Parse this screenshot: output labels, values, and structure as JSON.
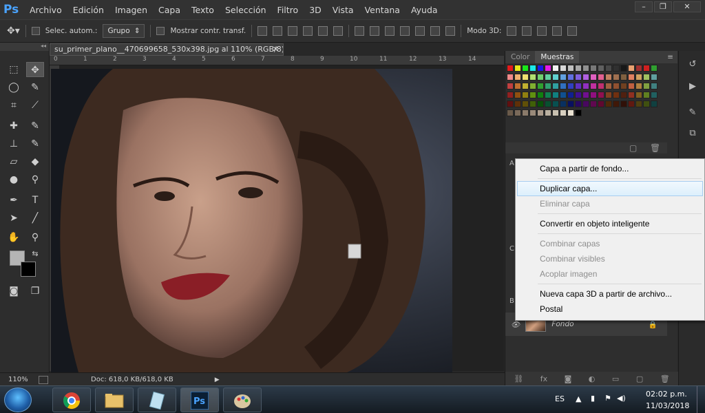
{
  "app": {
    "logo": "Ps"
  },
  "menu": [
    "Archivo",
    "Edición",
    "Imagen",
    "Capa",
    "Texto",
    "Selección",
    "Filtro",
    "3D",
    "Vista",
    "Ventana",
    "Ayuda"
  ],
  "window_controls": [
    "minimize",
    "restore",
    "close"
  ],
  "options_bar": {
    "auto_select_label": "Selec. autom.:",
    "group_value": "Grupo",
    "show_transform_label": "Mostrar contr. transf.",
    "mode_3d_label": "Modo 3D:"
  },
  "document": {
    "tab_title": "su_primer_plano__470699658_530x398.jpg al 110% (RGB/8) *",
    "zoom": "110%",
    "doc_info": "Doc: 618,0 KB/618,0 KB",
    "ruler_h": [
      "0",
      "1",
      "2",
      "3",
      "4",
      "5",
      "6",
      "7",
      "8",
      "9",
      "10",
      "11",
      "12",
      "13",
      "14"
    ],
    "ruler_v": [
      "8"
    ]
  },
  "panels": {
    "tabs": [
      "Color",
      "Muestras"
    ],
    "layer_name": "Fondo",
    "layer_side_letters": [
      "A",
      "C",
      "B"
    ]
  },
  "context_menu": {
    "items": [
      {
        "label": "Capa a partir de fondo...",
        "state": "normal"
      },
      {
        "label": "Duplicar capa...",
        "state": "highlighted"
      },
      {
        "label": "Eliminar capa",
        "state": "disabled"
      },
      {
        "label": "Convertir en objeto inteligente",
        "state": "normal"
      },
      {
        "label": "Combinar capas",
        "state": "disabled"
      },
      {
        "label": "Combinar visibles",
        "state": "disabled"
      },
      {
        "label": "Acoplar imagen",
        "state": "disabled"
      },
      {
        "label": "Nueva capa 3D a partir de archivo...",
        "state": "normal"
      },
      {
        "label": "Postal",
        "state": "normal"
      }
    ]
  },
  "taskbar": {
    "language": "ES",
    "time": "02:02 p.m.",
    "date": "11/03/2018",
    "apps": [
      "chrome-icon",
      "folder-icon",
      "notes-icon",
      "photoshop-icon",
      "paint-icon"
    ]
  },
  "colors": {
    "accent": "#4aa3ff",
    "menu_highlight": "#dceffc"
  }
}
